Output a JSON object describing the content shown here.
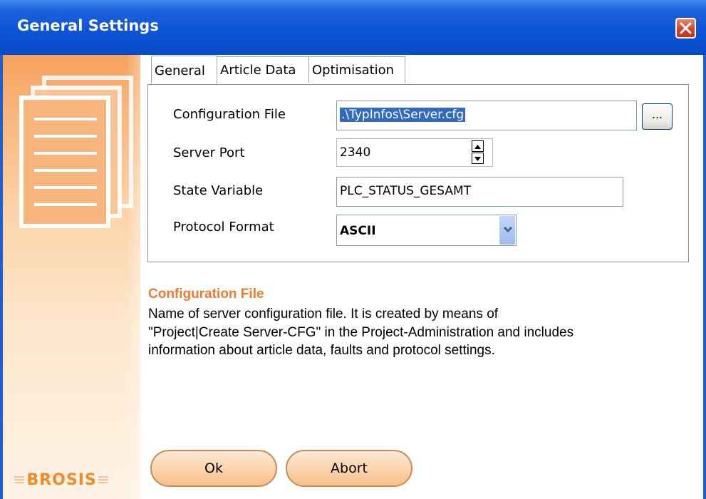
{
  "window": {
    "title": "General Settings"
  },
  "brand": {
    "logo_text": "BROSIS"
  },
  "tabs": [
    {
      "label": "General",
      "active": true
    },
    {
      "label": "Article Data",
      "active": false
    },
    {
      "label": "Optimisation",
      "active": false
    }
  ],
  "general": {
    "config_file": {
      "label": "Configuration File",
      "value": ".\\TypInfos\\Server.cfg",
      "browse_label": "..."
    },
    "server_port": {
      "label": "Server Port",
      "value": "2340"
    },
    "state_variable": {
      "label": "State Variable",
      "value": "PLC_STATUS_GESAMT"
    },
    "protocol_format": {
      "label": "Protocol Format",
      "value": "ASCII"
    }
  },
  "help": {
    "title": "Configuration File",
    "lines": [
      "Name of server configuration file. It is created by means of",
      "\"Project|Create Server-CFG\" in the Project-Administration and includes",
      "information about article data, faults and protocol settings."
    ]
  },
  "buttons": {
    "ok_label": "Ok",
    "abort_label": "Abort"
  },
  "colors": {
    "titlebar": "#0c54d8",
    "accent_orange": "#f07a30",
    "selection": "#316ac5"
  }
}
